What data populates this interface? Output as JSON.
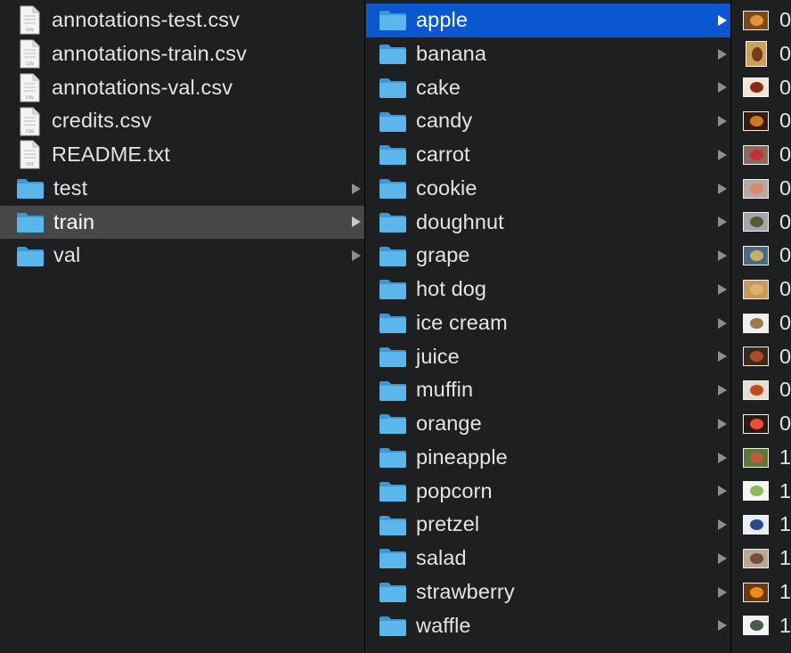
{
  "col1": {
    "items": [
      {
        "label": "annotations-test.csv",
        "kind": "file",
        "badge": "CSV"
      },
      {
        "label": "annotations-train.csv",
        "kind": "file",
        "badge": "CSV"
      },
      {
        "label": "annotations-val.csv",
        "kind": "file",
        "badge": "CSV"
      },
      {
        "label": "credits.csv",
        "kind": "file",
        "badge": "CSV"
      },
      {
        "label": "README.txt",
        "kind": "file",
        "badge": "TXT"
      },
      {
        "label": "test",
        "kind": "folder"
      },
      {
        "label": "train",
        "kind": "folder",
        "state": "highlighted"
      },
      {
        "label": "val",
        "kind": "folder"
      }
    ]
  },
  "col2": {
    "items": [
      {
        "label": "apple",
        "state": "selected"
      },
      {
        "label": "banana"
      },
      {
        "label": "cake"
      },
      {
        "label": "candy"
      },
      {
        "label": "carrot"
      },
      {
        "label": "cookie"
      },
      {
        "label": "doughnut"
      },
      {
        "label": "grape"
      },
      {
        "label": "hot dog"
      },
      {
        "label": "ice cream"
      },
      {
        "label": "juice"
      },
      {
        "label": "muffin"
      },
      {
        "label": "orange"
      },
      {
        "label": "pineapple"
      },
      {
        "label": "popcorn"
      },
      {
        "label": "pretzel"
      },
      {
        "label": "salad"
      },
      {
        "label": "strawberry"
      },
      {
        "label": "waffle"
      }
    ]
  },
  "col3": {
    "items": [
      {
        "label": "0",
        "thumb": {
          "bg": "#7a4a1a",
          "fg": "#e8923a"
        }
      },
      {
        "label": "0",
        "thumb": {
          "bg": "#c9a25a",
          "fg": "#7a3a14"
        },
        "tall": true
      },
      {
        "label": "0",
        "thumb": {
          "bg": "#f2e6d6",
          "fg": "#8a2a14"
        }
      },
      {
        "label": "0",
        "thumb": {
          "bg": "#3a1a0a",
          "fg": "#d0781c"
        }
      },
      {
        "label": "0",
        "thumb": {
          "bg": "#8a6a5a",
          "fg": "#c0303a"
        }
      },
      {
        "label": "0",
        "thumb": {
          "bg": "#b8a8a0",
          "fg": "#d88a6a"
        }
      },
      {
        "label": "0",
        "thumb": {
          "bg": "#a0a6aa",
          "fg": "#5a5a3a"
        }
      },
      {
        "label": "0",
        "thumb": {
          "bg": "#4a6a88",
          "fg": "#c8b060"
        }
      },
      {
        "label": "0",
        "thumb": {
          "bg": "#c89a5a",
          "fg": "#e0b070"
        }
      },
      {
        "label": "0",
        "thumb": {
          "bg": "#f0f0f0",
          "fg": "#9a7a4a"
        }
      },
      {
        "label": "0",
        "thumb": {
          "bg": "#3a2a1a",
          "fg": "#b04a2a"
        }
      },
      {
        "label": "0",
        "thumb": {
          "bg": "#e8dcd0",
          "fg": "#c04a1a"
        }
      },
      {
        "label": "0",
        "thumb": {
          "bg": "#2a1a12",
          "fg": "#e85030"
        }
      },
      {
        "label": "1",
        "thumb": {
          "bg": "#5a7a3a",
          "fg": "#c05a3a"
        }
      },
      {
        "label": "1",
        "thumb": {
          "bg": "#f4f4f2",
          "fg": "#8aba5a"
        }
      },
      {
        "label": "1",
        "thumb": {
          "bg": "#e8eef4",
          "fg": "#2a4a8a"
        }
      },
      {
        "label": "1",
        "thumb": {
          "bg": "#b8a898",
          "fg": "#7a4a3a"
        }
      },
      {
        "label": "1",
        "thumb": {
          "bg": "#6a3a0a",
          "fg": "#f08a1a"
        }
      },
      {
        "label": "1",
        "thumb": {
          "bg": "#f4f4f4",
          "fg": "#4a5a4a"
        }
      }
    ]
  },
  "colors": {
    "background": "#1e1f21",
    "selection": "#0a57d0",
    "highlight": "#464749",
    "folder": "#5bb6ec",
    "text": "#e4e4e6"
  }
}
